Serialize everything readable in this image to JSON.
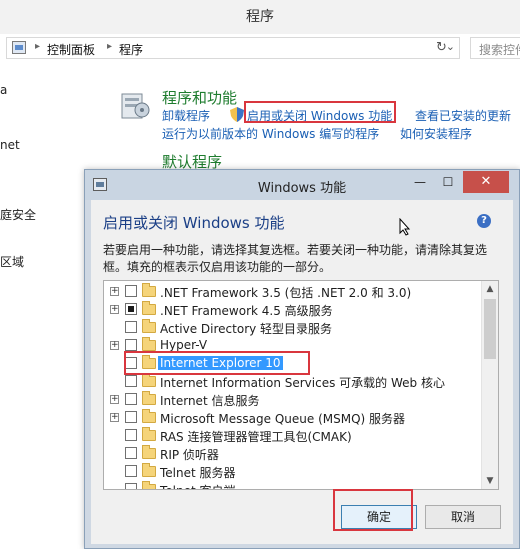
{
  "window": {
    "title": "程序"
  },
  "address_bar": {
    "crumbs": [
      "控制面板",
      "程序"
    ],
    "separator": "▸",
    "dropdown": "⌄",
    "refresh": "↻",
    "search_placeholder": "搜索控件"
  },
  "left_nav": [
    "a",
    "net",
    "庭安全",
    "区域"
  ],
  "programs": {
    "title": "程序和功能",
    "links": {
      "uninstall": "卸载程序",
      "turn_features": "启用或关闭 Windows 功能",
      "view_updates": "查看已安装的更新",
      "run_older": "运行为以前版本的 Windows 编写的程序",
      "how_install": "如何安装程序"
    }
  },
  "default_programs": {
    "title": "默认程序"
  },
  "dialog": {
    "title": "Windows 功能",
    "heading": "启用或关闭 Windows 功能",
    "description": "若要启用一种功能，请选择其复选框。若要关闭一种功能，请清除其复选框。填充的框表示仅启用该功能的一部分。",
    "help": "?",
    "controls": {
      "minimize": "—",
      "maximize": "☐",
      "close": "✕"
    },
    "features": [
      {
        "label": ".NET Framework 3.5 (包括 .NET 2.0 和 3.0)",
        "expandable": true,
        "state": "unchecked"
      },
      {
        "label": ".NET Framework 4.5 高级服务",
        "expandable": true,
        "state": "partial"
      },
      {
        "label": "Active Directory 轻型目录服务",
        "expandable": false,
        "state": "unchecked"
      },
      {
        "label": "Hyper-V",
        "expandable": true,
        "state": "unchecked"
      },
      {
        "label": "Internet Explorer 10",
        "expandable": false,
        "state": "unchecked",
        "selected": true
      },
      {
        "label": "Internet Information Services 可承载的 Web 核心",
        "expandable": false,
        "state": "unchecked"
      },
      {
        "label": "Internet 信息服务",
        "expandable": true,
        "state": "unchecked"
      },
      {
        "label": "Microsoft Message Queue (MSMQ) 服务器",
        "expandable": true,
        "state": "unchecked"
      },
      {
        "label": "RAS 连接管理器管理工具包(CMAK)",
        "expandable": false,
        "state": "unchecked"
      },
      {
        "label": "RIP 侦听器",
        "expandable": false,
        "state": "unchecked"
      },
      {
        "label": "Telnet 服务器",
        "expandable": false,
        "state": "unchecked"
      },
      {
        "label": "Telnet 客户端",
        "expandable": false,
        "state": "unchecked"
      }
    ],
    "expand_glyph": "+",
    "scroll_up": "▲",
    "scroll_down": "▼",
    "ok_label": "确定",
    "cancel_label": "取消"
  },
  "colors": {
    "link": "#1a5fb4",
    "section_title": "#1e7c2e",
    "highlight_box": "#d9363e",
    "selection": "#3399ff",
    "close_button": "#c7504a"
  },
  "icons": [
    "control-panel-icon",
    "programs-icon",
    "shield-icon",
    "help-icon",
    "folder-icon",
    "cursor-icon"
  ]
}
